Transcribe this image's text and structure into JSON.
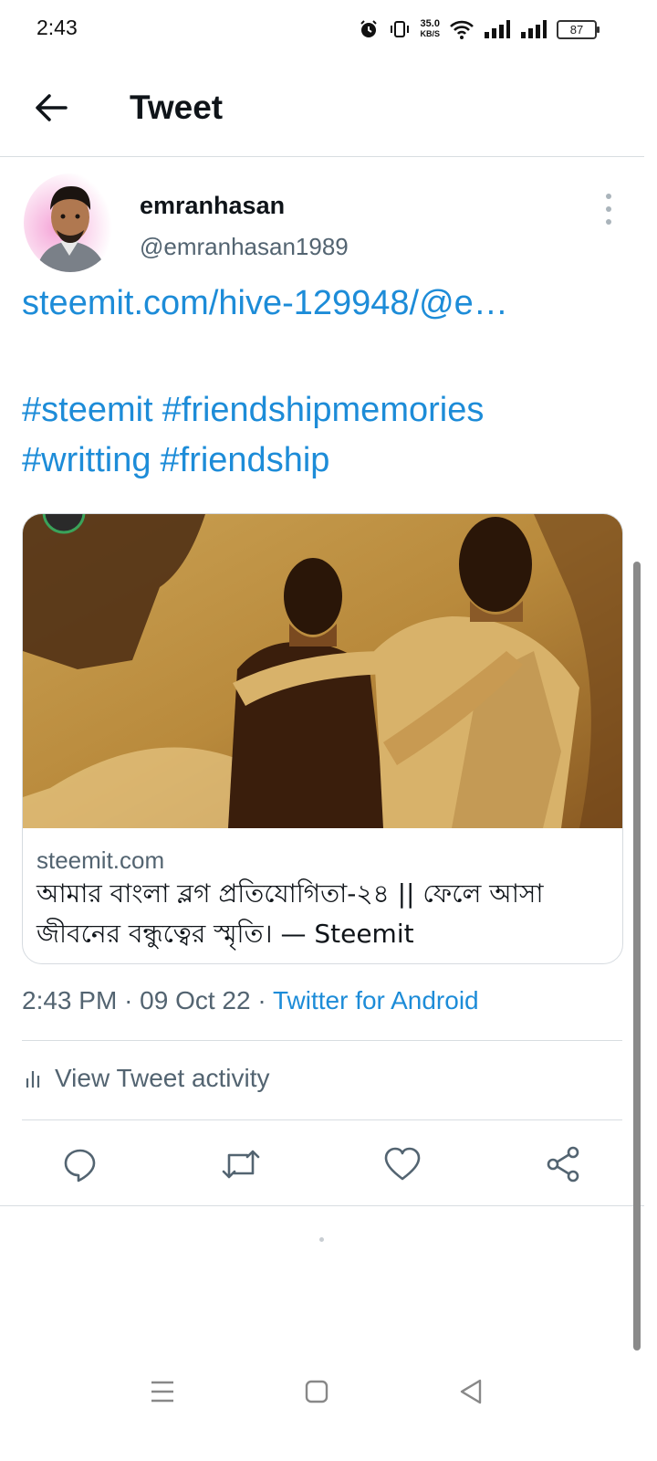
{
  "status_bar": {
    "time": "2:43",
    "net_speed_value": "35.0",
    "net_speed_unit": "KB/S",
    "battery": "87"
  },
  "header": {
    "title": "Tweet"
  },
  "author": {
    "display_name": "emranhasan",
    "handle": "@emranhasan1989"
  },
  "tweet": {
    "link_text": "steemit.com/hive-129948/@e…",
    "hashtags": [
      "#steemit",
      "#friendshipmemories",
      "#writting",
      "#friendship"
    ]
  },
  "card": {
    "domain": "steemit.com",
    "title": "আমার বাংলা ব্লগ প্রতিযোগিতা-২৪ || ফেলে আসা জীবনের বন্ধুত্বের স্মৃতি। — Steemit"
  },
  "meta": {
    "time": "2:43 PM",
    "date": "09 Oct 22",
    "separator": "·",
    "source": "Twitter for Android"
  },
  "activity": {
    "label": "View Tweet activity"
  },
  "icons": [
    "alarm-icon",
    "vibrate-icon",
    "wifi-icon",
    "signal-icon",
    "back-arrow-icon",
    "more-icon",
    "activity-icon",
    "reply-icon",
    "retweet-icon",
    "like-icon",
    "share-icon",
    "menu-icon",
    "home-icon",
    "nav-back-icon"
  ],
  "colors": {
    "link": "#1d8cd8",
    "secondary_text": "#536471",
    "primary_text": "#0f1419",
    "divider": "#d8dde1"
  }
}
